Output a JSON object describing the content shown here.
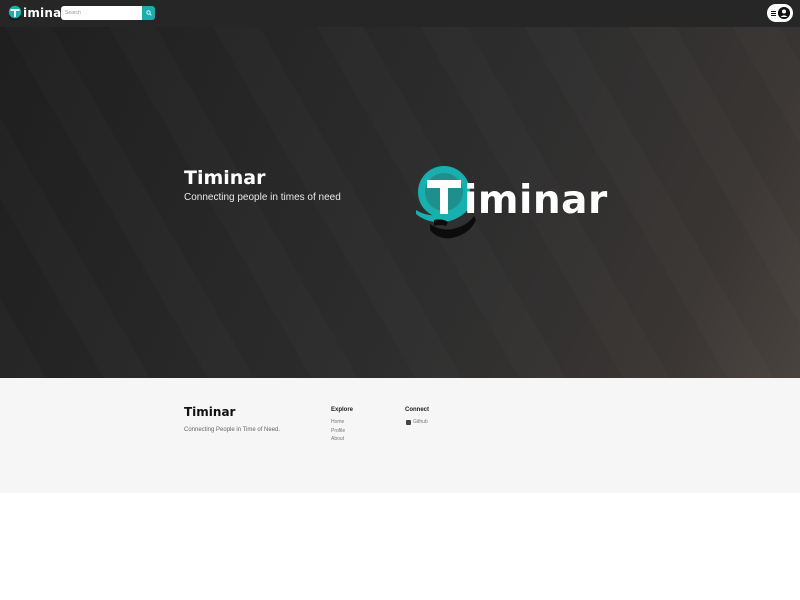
{
  "brand": {
    "name": "Timinar",
    "word": "iminar"
  },
  "search": {
    "placeholder": "Search"
  },
  "hero": {
    "title": "Timinar",
    "subtitle": "Connecting people in times of need",
    "logo_word": "iminar"
  },
  "footer": {
    "title": "Timinar",
    "tagline": "Connecting People in Time of Need.",
    "explore": {
      "heading": "Explore",
      "links": [
        "Home",
        "Profile",
        "About"
      ]
    },
    "connect": {
      "heading": "Connect",
      "github": "Github"
    }
  },
  "colors": {
    "accent": "#17b0ae",
    "nav_bg": "#262626",
    "footer_bg": "#f6f6f6"
  },
  "icons": [
    "search-icon",
    "menu-icon",
    "user-avatar-icon",
    "github-icon"
  ]
}
